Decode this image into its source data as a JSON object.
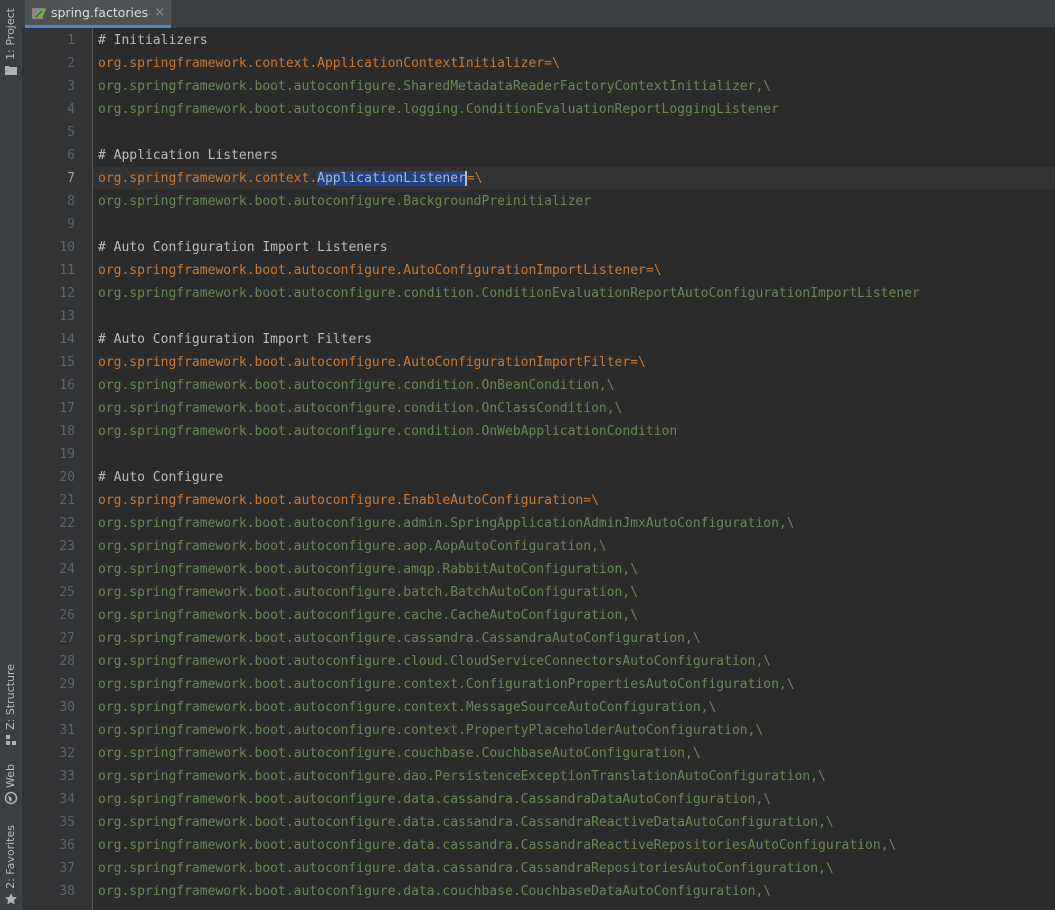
{
  "tool_strip": {
    "project": "1: Project",
    "structure": "Z: Structure",
    "web": "Web",
    "favorites": "2: Favorites"
  },
  "tab": {
    "title": "spring.factories",
    "close": "×"
  },
  "editor": {
    "current_line": 7,
    "lines": [
      {
        "n": "1",
        "kind": "comment",
        "text": "# Initializers"
      },
      {
        "n": "2",
        "kind": "key",
        "key": "org.springframework.context.ApplicationContextInitializer",
        "op": "=\\"
      },
      {
        "n": "3",
        "kind": "val",
        "text": "org.springframework.boot.autoconfigure.SharedMetadataReaderFactoryContextInitializer,\\"
      },
      {
        "n": "4",
        "kind": "val",
        "text": "org.springframework.boot.autoconfigure.logging.ConditionEvaluationReportLoggingListener"
      },
      {
        "n": "5",
        "kind": "blank",
        "text": ""
      },
      {
        "n": "6",
        "kind": "comment",
        "text": "# Application Listeners"
      },
      {
        "n": "7",
        "kind": "keysel",
        "prefix": "org.springframework.context.",
        "selected": "ApplicationListener",
        "op": "=\\"
      },
      {
        "n": "8",
        "kind": "val",
        "text": "org.springframework.boot.autoconfigure.BackgroundPreinitializer"
      },
      {
        "n": "9",
        "kind": "blank",
        "text": ""
      },
      {
        "n": "10",
        "kind": "comment",
        "text": "# Auto Configuration Import Listeners"
      },
      {
        "n": "11",
        "kind": "key",
        "key": "org.springframework.boot.autoconfigure.AutoConfigurationImportListener",
        "op": "=\\"
      },
      {
        "n": "12",
        "kind": "val",
        "text": "org.springframework.boot.autoconfigure.condition.ConditionEvaluationReportAutoConfigurationImportListener"
      },
      {
        "n": "13",
        "kind": "blank",
        "text": ""
      },
      {
        "n": "14",
        "kind": "comment",
        "text": "# Auto Configuration Import Filters"
      },
      {
        "n": "15",
        "kind": "key",
        "key": "org.springframework.boot.autoconfigure.AutoConfigurationImportFilter",
        "op": "=\\"
      },
      {
        "n": "16",
        "kind": "val",
        "text": "org.springframework.boot.autoconfigure.condition.OnBeanCondition,\\"
      },
      {
        "n": "17",
        "kind": "val",
        "text": "org.springframework.boot.autoconfigure.condition.OnClassCondition,\\"
      },
      {
        "n": "18",
        "kind": "val",
        "text": "org.springframework.boot.autoconfigure.condition.OnWebApplicationCondition"
      },
      {
        "n": "19",
        "kind": "blank",
        "text": ""
      },
      {
        "n": "20",
        "kind": "comment",
        "text": "# Auto Configure"
      },
      {
        "n": "21",
        "kind": "key",
        "key": "org.springframework.boot.autoconfigure.EnableAutoConfiguration",
        "op": "=\\"
      },
      {
        "n": "22",
        "kind": "val",
        "text": "org.springframework.boot.autoconfigure.admin.SpringApplicationAdminJmxAutoConfiguration,\\"
      },
      {
        "n": "23",
        "kind": "val",
        "text": "org.springframework.boot.autoconfigure.aop.AopAutoConfiguration,\\"
      },
      {
        "n": "24",
        "kind": "val",
        "text": "org.springframework.boot.autoconfigure.amqp.RabbitAutoConfiguration,\\"
      },
      {
        "n": "25",
        "kind": "val",
        "text": "org.springframework.boot.autoconfigure.batch.BatchAutoConfiguration,\\"
      },
      {
        "n": "26",
        "kind": "val",
        "text": "org.springframework.boot.autoconfigure.cache.CacheAutoConfiguration,\\"
      },
      {
        "n": "27",
        "kind": "val",
        "text": "org.springframework.boot.autoconfigure.cassandra.CassandraAutoConfiguration,\\"
      },
      {
        "n": "28",
        "kind": "val",
        "text": "org.springframework.boot.autoconfigure.cloud.CloudServiceConnectorsAutoConfiguration,\\"
      },
      {
        "n": "29",
        "kind": "val",
        "text": "org.springframework.boot.autoconfigure.context.ConfigurationPropertiesAutoConfiguration,\\"
      },
      {
        "n": "30",
        "kind": "val",
        "text": "org.springframework.boot.autoconfigure.context.MessageSourceAutoConfiguration,\\"
      },
      {
        "n": "31",
        "kind": "val",
        "text": "org.springframework.boot.autoconfigure.context.PropertyPlaceholderAutoConfiguration,\\"
      },
      {
        "n": "32",
        "kind": "val",
        "text": "org.springframework.boot.autoconfigure.couchbase.CouchbaseAutoConfiguration,\\"
      },
      {
        "n": "33",
        "kind": "val",
        "text": "org.springframework.boot.autoconfigure.dao.PersistenceExceptionTranslationAutoConfiguration,\\"
      },
      {
        "n": "34",
        "kind": "val",
        "text": "org.springframework.boot.autoconfigure.data.cassandra.CassandraDataAutoConfiguration,\\"
      },
      {
        "n": "35",
        "kind": "val",
        "text": "org.springframework.boot.autoconfigure.data.cassandra.CassandraReactiveDataAutoConfiguration,\\"
      },
      {
        "n": "36",
        "kind": "val",
        "text": "org.springframework.boot.autoconfigure.data.cassandra.CassandraReactiveRepositoriesAutoConfiguration,\\"
      },
      {
        "n": "37",
        "kind": "val",
        "text": "org.springframework.boot.autoconfigure.data.cassandra.CassandraRepositoriesAutoConfiguration,\\"
      },
      {
        "n": "38",
        "kind": "val",
        "text": "org.springframework.boot.autoconfigure.data.couchbase.CouchbaseDataAutoConfiguration,\\"
      }
    ]
  }
}
